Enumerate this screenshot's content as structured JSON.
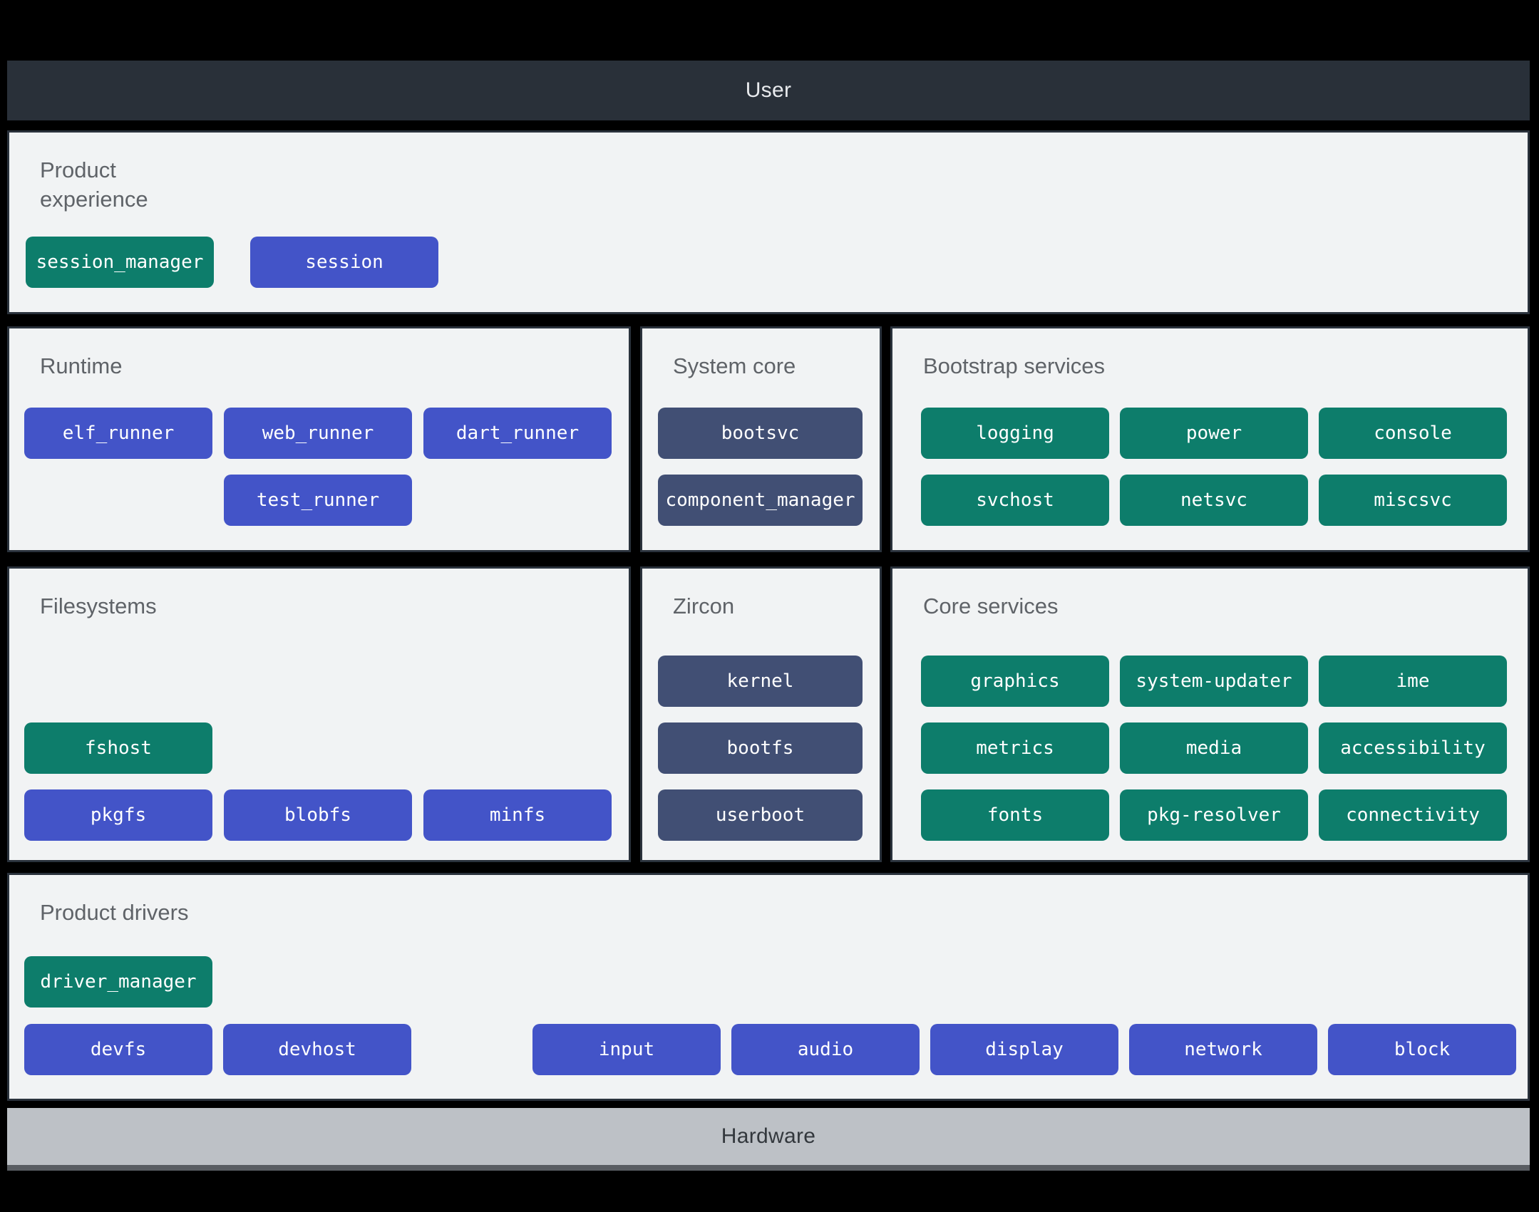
{
  "layers": {
    "user": "User",
    "hardware": "Hardware"
  },
  "colors": {
    "background": "#000000",
    "user_bar": "#293039",
    "panel_background": "#f1f3f4",
    "panel_border": "#2a323c",
    "section_title_text": "#5f6368",
    "node_green": "#0d7d6b",
    "node_indigo": "#4354c8",
    "node_slate": "#414f74",
    "node_text": "#ffffff",
    "hardware_bar": "#bdc1c6",
    "hardware_bar_edge": "#595d62",
    "hardware_text": "#33383d"
  },
  "sections": {
    "product_experience": {
      "title": "Product experience",
      "items": [
        {
          "label": "session_manager",
          "type": "green"
        },
        {
          "label": "session",
          "type": "indigo"
        }
      ]
    },
    "runtime": {
      "title": "Runtime",
      "items": [
        {
          "label": "elf_runner",
          "type": "indigo"
        },
        {
          "label": "web_runner",
          "type": "indigo"
        },
        {
          "label": "dart_runner",
          "type": "indigo"
        },
        {
          "label": "test_runner",
          "type": "indigo"
        }
      ]
    },
    "system_core": {
      "title": "System core",
      "items": [
        {
          "label": "bootsvc",
          "type": "slate"
        },
        {
          "label": "component_manager",
          "type": "slate"
        }
      ]
    },
    "bootstrap_services": {
      "title": "Bootstrap services",
      "items": [
        {
          "label": "logging",
          "type": "green"
        },
        {
          "label": "power",
          "type": "green"
        },
        {
          "label": "console",
          "type": "green"
        },
        {
          "label": "svchost",
          "type": "green"
        },
        {
          "label": "netsvc",
          "type": "green"
        },
        {
          "label": "miscsvc",
          "type": "green"
        }
      ]
    },
    "filesystems": {
      "title": "Filesystems",
      "items": [
        {
          "label": "fshost",
          "type": "green"
        },
        {
          "label": "pkgfs",
          "type": "indigo"
        },
        {
          "label": "blobfs",
          "type": "indigo"
        },
        {
          "label": "minfs",
          "type": "indigo"
        }
      ]
    },
    "zircon": {
      "title": "Zircon",
      "items": [
        {
          "label": "kernel",
          "type": "slate"
        },
        {
          "label": "bootfs",
          "type": "slate"
        },
        {
          "label": "userboot",
          "type": "slate"
        }
      ]
    },
    "core_services": {
      "title": "Core services",
      "items": [
        {
          "label": "graphics",
          "type": "green"
        },
        {
          "label": "system-updater",
          "type": "green"
        },
        {
          "label": "ime",
          "type": "green"
        },
        {
          "label": "metrics",
          "type": "green"
        },
        {
          "label": "media",
          "type": "green"
        },
        {
          "label": "accessibility",
          "type": "green"
        },
        {
          "label": "fonts",
          "type": "green"
        },
        {
          "label": "pkg-resolver",
          "type": "green"
        },
        {
          "label": "connectivity",
          "type": "green"
        }
      ]
    },
    "product_drivers": {
      "title": "Product drivers",
      "items": [
        {
          "label": "driver_manager",
          "type": "green"
        },
        {
          "label": "devfs",
          "type": "indigo"
        },
        {
          "label": "devhost",
          "type": "indigo"
        },
        {
          "label": "input",
          "type": "indigo"
        },
        {
          "label": "audio",
          "type": "indigo"
        },
        {
          "label": "display",
          "type": "indigo"
        },
        {
          "label": "network",
          "type": "indigo"
        },
        {
          "label": "block",
          "type": "indigo"
        }
      ]
    }
  }
}
